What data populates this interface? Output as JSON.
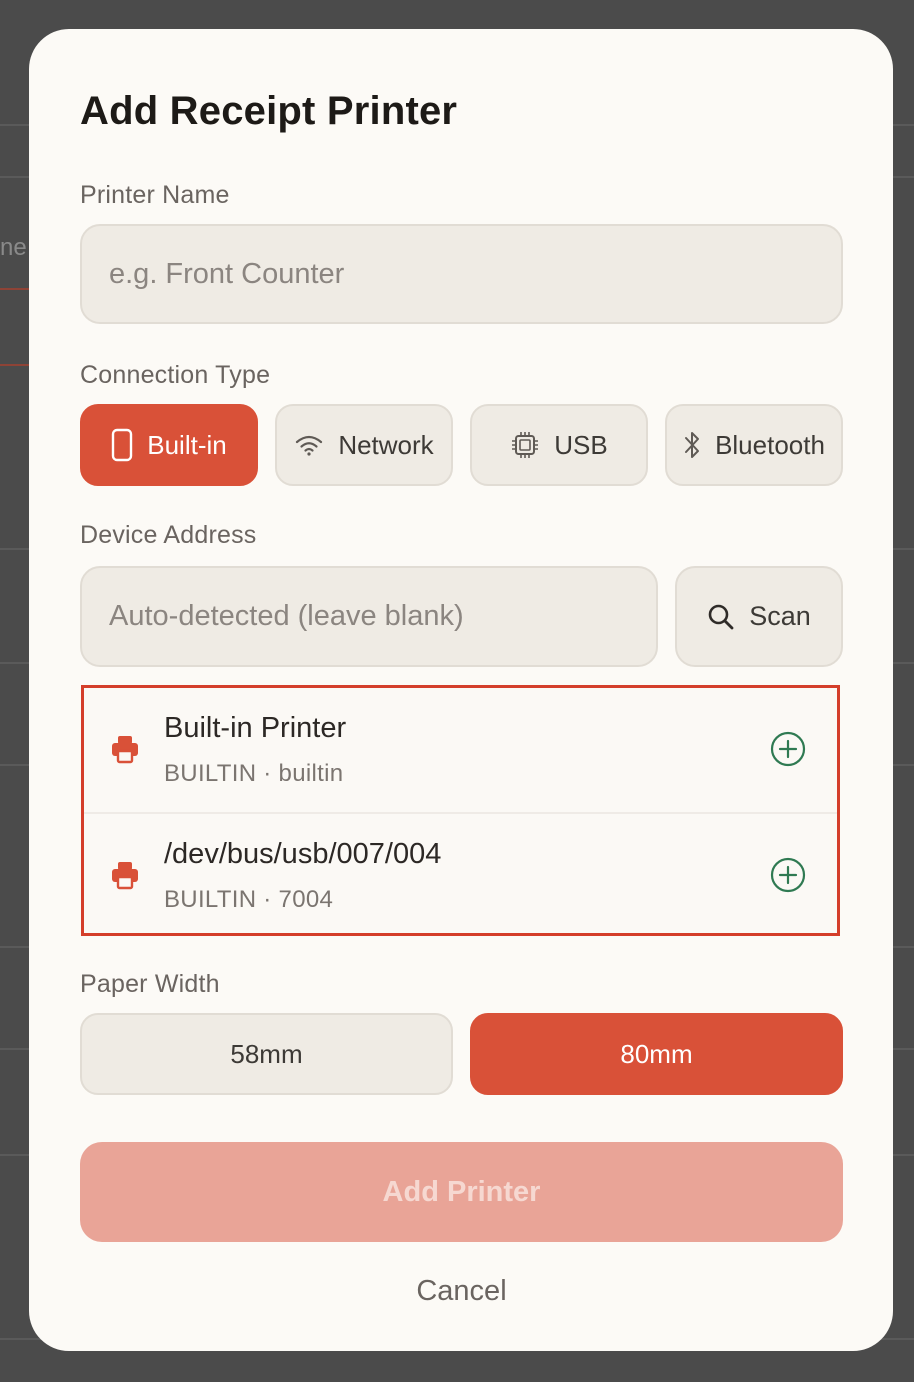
{
  "background": {
    "partial_text": "ne"
  },
  "modal": {
    "title": "Add Receipt Printer",
    "printer_name": {
      "label": "Printer Name",
      "value": "",
      "placeholder": "e.g. Front Counter"
    },
    "connection_type": {
      "label": "Connection Type",
      "selected": "Built-in",
      "options": [
        {
          "label": "Built-in",
          "icon": "phone-icon"
        },
        {
          "label": "Network",
          "icon": "wifi-icon"
        },
        {
          "label": "USB",
          "icon": "chip-icon"
        },
        {
          "label": "Bluetooth",
          "icon": "bluetooth-icon"
        }
      ]
    },
    "device_address": {
      "label": "Device Address",
      "value": "",
      "placeholder": "Auto-detected (leave blank)",
      "scan_label": "Scan",
      "scan_icon": "search-icon"
    },
    "devices": [
      {
        "name": "Built-in Printer",
        "subtitle": "BUILTIN · builtin",
        "icon": "printer-icon",
        "action_icon": "add-circle-icon"
      },
      {
        "name": "/dev/bus/usb/007/004",
        "subtitle": "BUILTIN · 7004",
        "icon": "printer-icon",
        "action_icon": "add-circle-icon"
      }
    ],
    "paper_width": {
      "label": "Paper Width",
      "selected": "80mm",
      "options": [
        "58mm",
        "80mm"
      ]
    },
    "add_button": "Add Printer",
    "cancel_button": "Cancel",
    "colors": {
      "accent": "#d95138",
      "accent_disabled": "#e9a497",
      "highlight_border": "#d43e2a",
      "add_icon_green": "#2f7a52",
      "surface": "#fcfaf6",
      "field": "#efebe4"
    }
  }
}
